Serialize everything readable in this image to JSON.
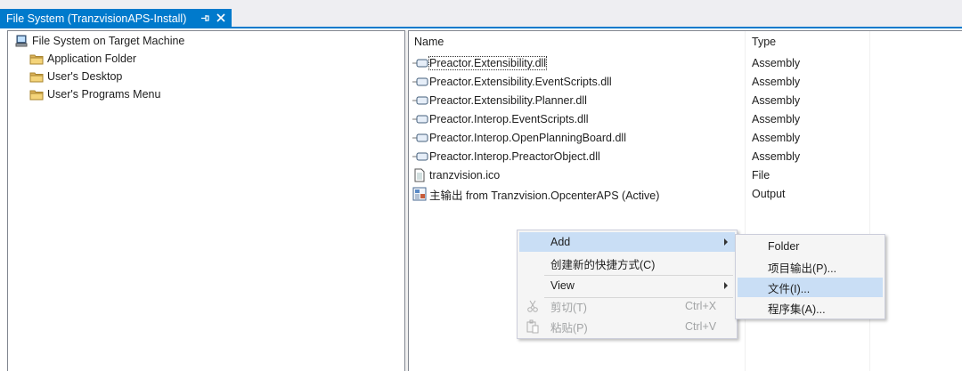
{
  "tab": {
    "title": "File System (TranzvisionAPS-Install)",
    "pin_glyph": "⊣",
    "close_glyph": "✕"
  },
  "tree": {
    "root": "File System on Target Machine",
    "items": [
      {
        "label": "Application Folder"
      },
      {
        "label": "User's Desktop"
      },
      {
        "label": "User's Programs Menu"
      }
    ]
  },
  "list": {
    "columns": {
      "name": "Name",
      "type": "Type"
    },
    "rows": [
      {
        "name": "Preactor.Extensibility.dll",
        "type": "Assembly",
        "icon": "assembly-icon"
      },
      {
        "name": "Preactor.Extensibility.EventScripts.dll",
        "type": "Assembly",
        "icon": "assembly-icon"
      },
      {
        "name": "Preactor.Extensibility.Planner.dll",
        "type": "Assembly",
        "icon": "assembly-icon"
      },
      {
        "name": "Preactor.Interop.EventScripts.dll",
        "type": "Assembly",
        "icon": "assembly-icon"
      },
      {
        "name": "Preactor.Interop.OpenPlanningBoard.dll",
        "type": "Assembly",
        "icon": "assembly-icon"
      },
      {
        "name": "Preactor.Interop.PreactorObject.dll",
        "type": "Assembly",
        "icon": "assembly-icon"
      },
      {
        "name": "tranzvision.ico",
        "type": "File",
        "icon": "file-icon"
      },
      {
        "name": "主输出 from Tranzvision.OpcenterAPS (Active)",
        "type": "Output",
        "icon": "project-output-icon"
      }
    ]
  },
  "context_menu": {
    "add": "Add",
    "new_shortcut": "创建新的快捷方式(C)",
    "view": "View",
    "cut": "剪切(T)",
    "cut_shortcut": "Ctrl+X",
    "paste": "粘贴(P)",
    "paste_shortcut": "Ctrl+V"
  },
  "submenu": {
    "folder": "Folder",
    "project_output": "项目输出(P)...",
    "file": "文件(I)...",
    "assembly": "程序集(A)..."
  },
  "colors": {
    "accent": "#007acc",
    "highlight": "#c9def5"
  }
}
